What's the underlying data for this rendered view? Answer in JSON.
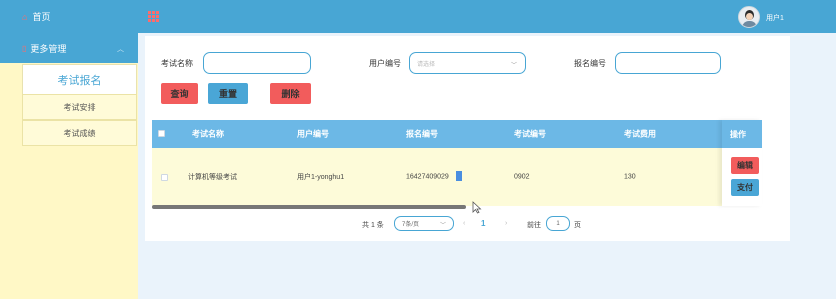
{
  "sidebar": {
    "home_label": "首页",
    "more_label": "更多管理",
    "items": [
      {
        "label": "考试报名"
      },
      {
        "label": "考试安排"
      },
      {
        "label": "考试成绩"
      }
    ]
  },
  "header": {
    "user_name": "用户1"
  },
  "search": {
    "exam_name_label": "考试名称",
    "exam_name_value": "",
    "user_no_label": "用户编号",
    "user_no_placeholder": "请选择",
    "reg_no_label": "报名编号",
    "reg_no_value": ""
  },
  "actions": {
    "query": "查询",
    "reset": "重置",
    "delete": "删除"
  },
  "table": {
    "columns": [
      "考试名称",
      "用户编号",
      "报名编号",
      "考试编号",
      "考试费用",
      "操作"
    ],
    "rows": [
      {
        "exam_name": "计算机等级考试",
        "user_no": "用户1-yonghu1",
        "reg_no": "16427409029",
        "exam_no": "0902",
        "fee": "130",
        "edit": "编辑",
        "pay": "支付"
      }
    ]
  },
  "pagination": {
    "total": "共 1 条",
    "page_size": "7条/页",
    "current": "1",
    "goto_prefix": "前往",
    "goto_value": "1",
    "goto_suffix": "页"
  },
  "colors": {
    "primary": "#48a6d4",
    "sidebar_bg": "#fff8c6",
    "danger": "#f25c5c",
    "table_header": "#6cb8e6",
    "row_bg": "#fdfbd9"
  }
}
